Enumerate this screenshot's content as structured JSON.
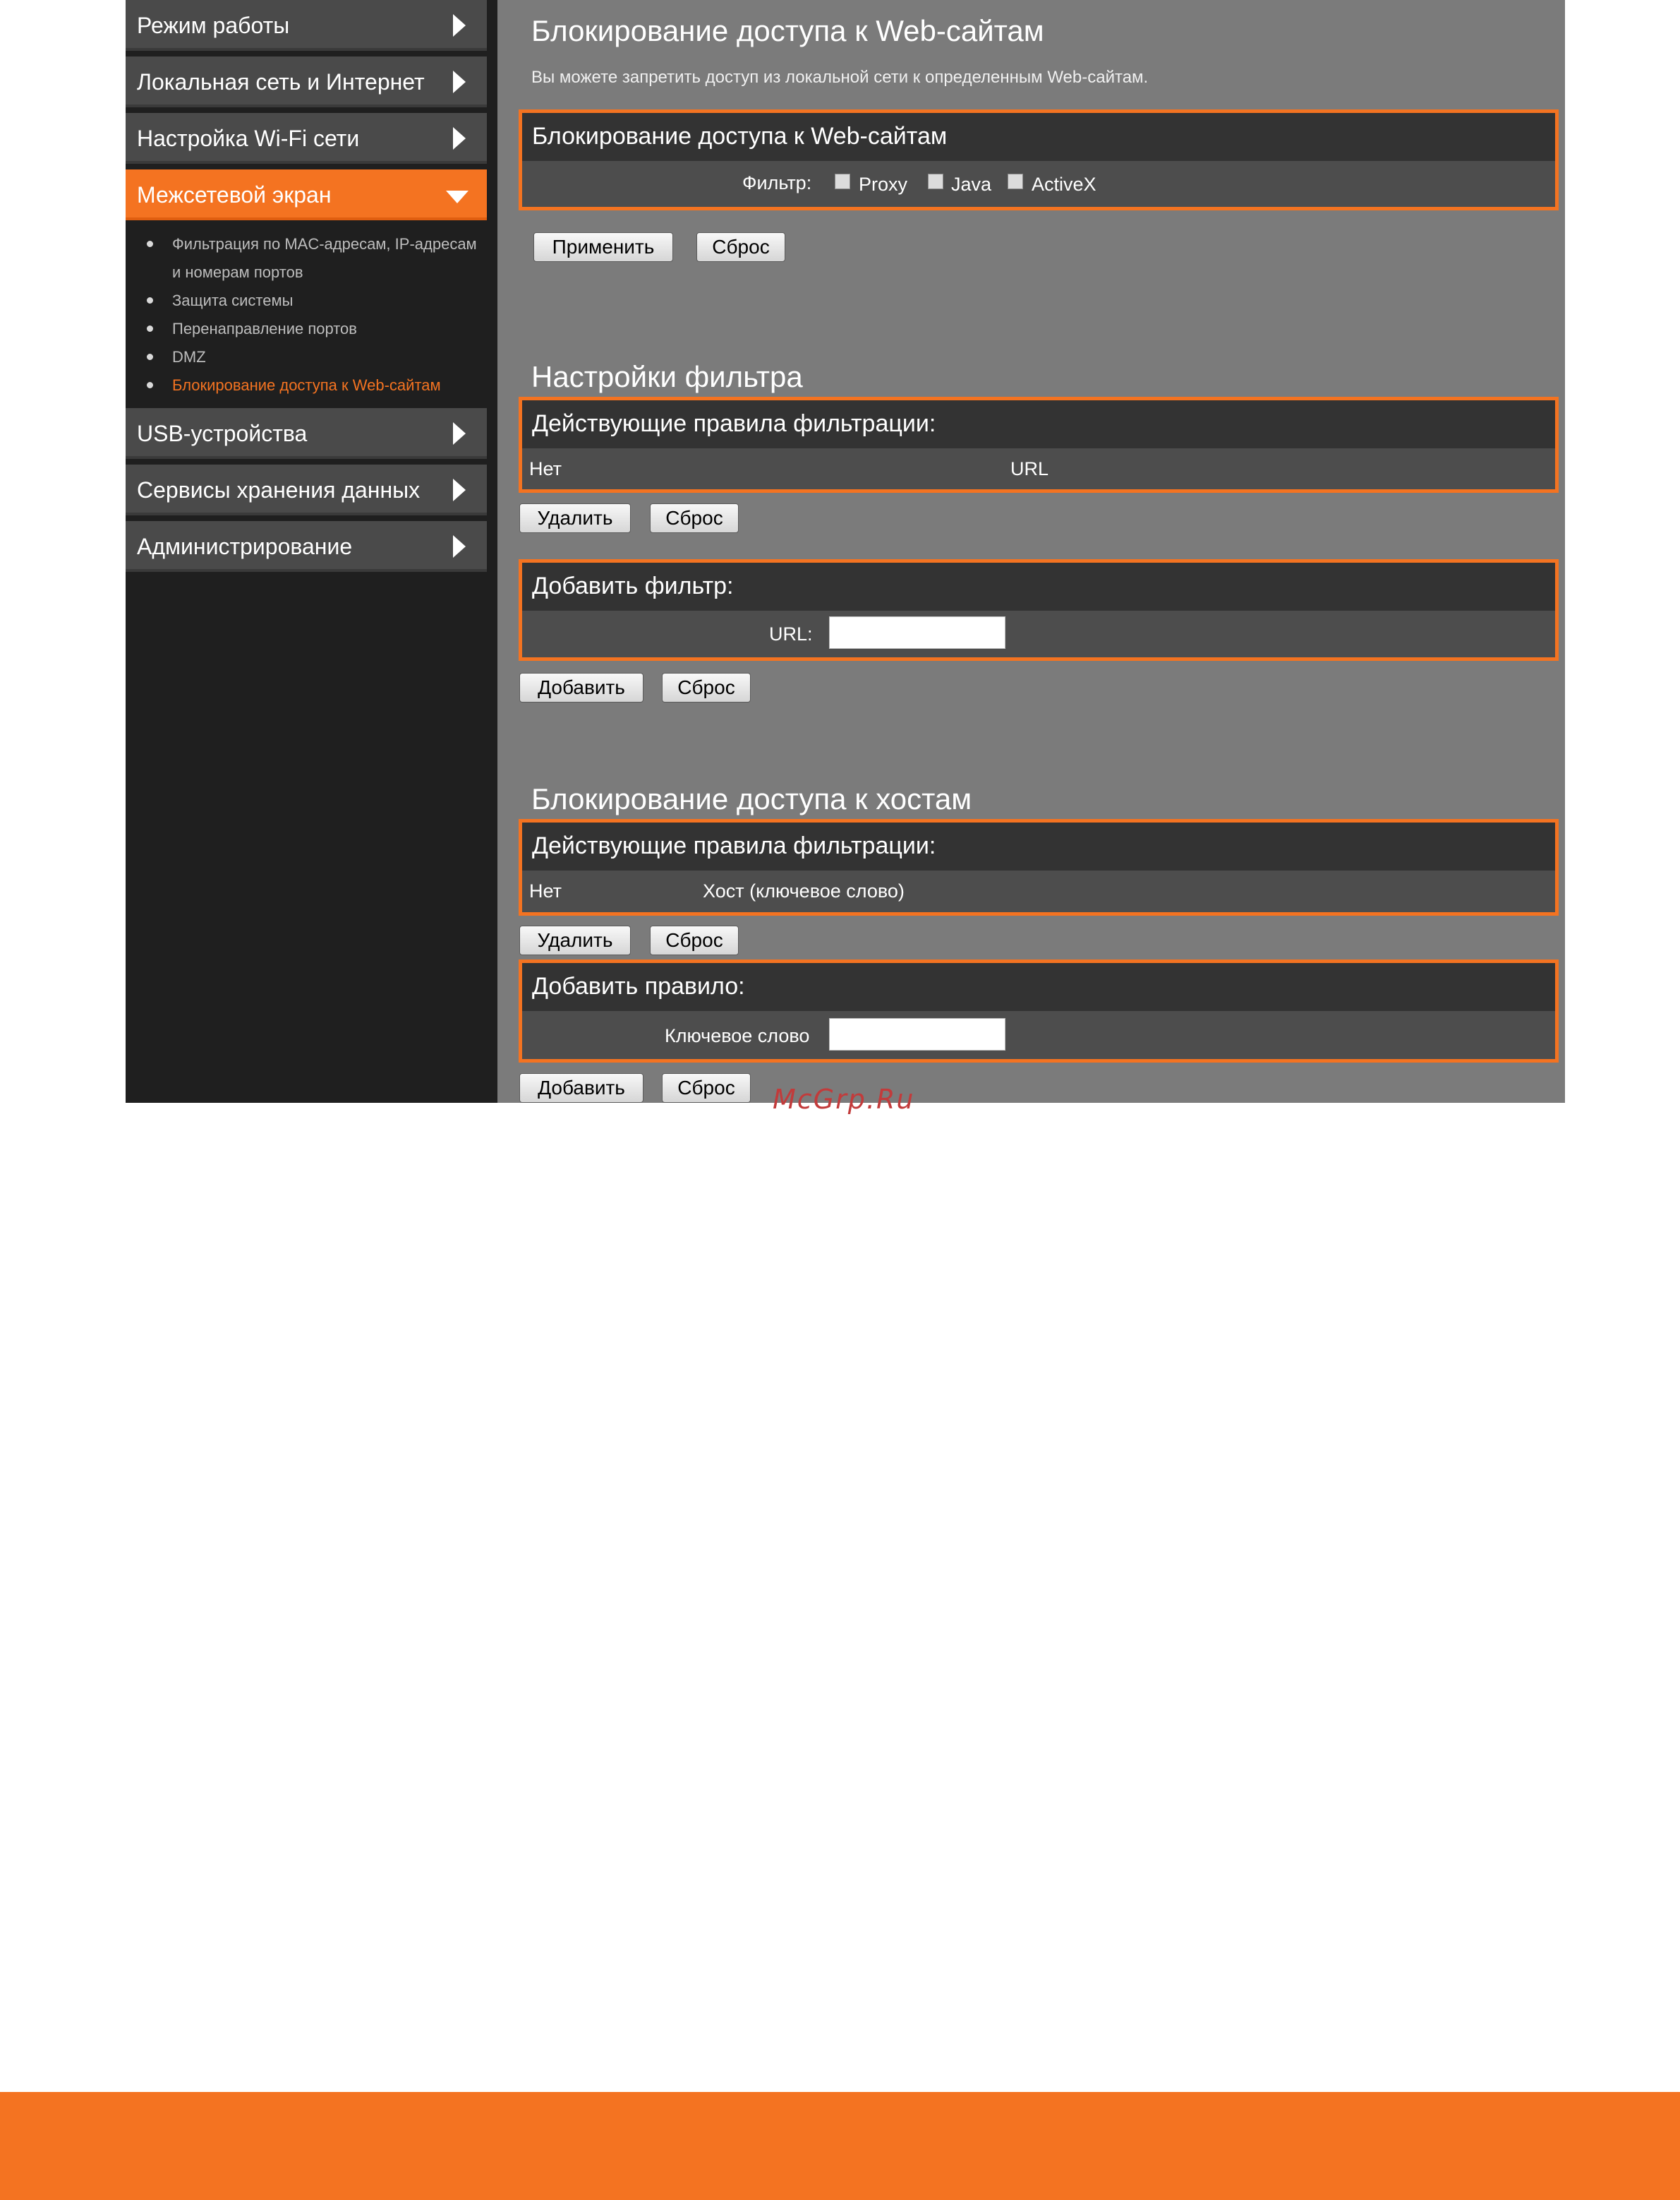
{
  "sidebar": {
    "items": [
      {
        "label": "Режим работы"
      },
      {
        "label": "Локальная сеть и Интернет"
      },
      {
        "label": "Настройка Wi-Fi сети"
      },
      {
        "label": "Межсетевой экран"
      },
      {
        "label": "USB-устройства"
      },
      {
        "label": "Сервисы хранения данных"
      },
      {
        "label": "Администрирование"
      }
    ],
    "subitems": [
      {
        "label": "Фильтрация по MAC-адресам, IP-адресам",
        "label2": "и номерам портов"
      },
      {
        "label": "Защита системы"
      },
      {
        "label": "Перенаправление портов"
      },
      {
        "label": "DMZ"
      },
      {
        "label": "Блокирование доступа к Web-сайтам"
      }
    ]
  },
  "main": {
    "title": "Блокирование доступа к Web-сайтам",
    "description": "Вы можете запретить доступ из локальной сети к определенным Web-сайтам.",
    "web_block_panel": {
      "header": "Блокирование доступа к Web-сайтам",
      "filter_label": "Фильтр:",
      "options": [
        "Proxy",
        "Java",
        "ActiveX"
      ]
    },
    "apply_button": "Применить",
    "reset_button": "Сброс",
    "filter_settings": {
      "title": "Настройки фильтра",
      "rules_header": "Действующие правила фильтрации:",
      "col_none": "Нет",
      "col_url": "URL",
      "delete_button": "Удалить",
      "reset_button": "Сброс",
      "add_header": "Добавить фильтр:",
      "url_label": "URL:",
      "url_value": "",
      "add_button": "Добавить",
      "add_reset_button": "Сброс"
    },
    "host_block": {
      "title": "Блокирование доступа к хостам",
      "rules_header": "Действующие правила фильтрации:",
      "col_none": "Нет",
      "col_host": "Хост (ключевое слово)",
      "delete_button": "Удалить",
      "reset_button": "Сброс",
      "add_header": "Добавить правило:",
      "keyword_label": "Ключевое слово",
      "keyword_value": "",
      "add_button": "Добавить",
      "add_reset_button": "Сброс"
    }
  },
  "watermark": "McGrp.Ru",
  "colors": {
    "accent": "#f47321",
    "sidebar_bg": "#1f1f1f",
    "content_bg": "#7b7b7b"
  }
}
